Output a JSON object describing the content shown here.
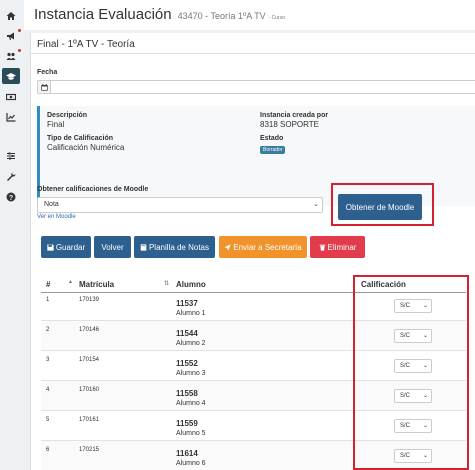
{
  "page": {
    "title": "Instancia Evaluación",
    "subtitle": "43470 - Teoría 1ºA TV",
    "subtitle_small": "- Curso"
  },
  "panel": {
    "heading": "Final - 1ºA TV - Teoría",
    "fecha_label": "Fecha",
    "fecha_value": ""
  },
  "info": {
    "descripcion_label": "Descripción",
    "descripcion_value": "Final",
    "tipo_label": "Tipo de Calificación",
    "tipo_value": "Calificación Numérica",
    "creada_label": "Instancia creada por",
    "creada_value": "8318 SOPORTE",
    "estado_label": "Estado",
    "estado_value": "Borrador"
  },
  "moodle": {
    "label": "Obtener calificaciones de Moodle",
    "select_value": "Nota",
    "link": "Ver en Moodle",
    "button": "Obtener de Moodle"
  },
  "actions": {
    "guardar": "Guardar",
    "volver": "Volver",
    "planilla": "Planilla de Notas",
    "enviar": "Enviar a Secretaría",
    "eliminar": "Eliminar"
  },
  "table": {
    "headers": {
      "num": "#",
      "matricula": "Matrícula",
      "alumno": "Alumno",
      "calificacion": "Calificación"
    },
    "rows": [
      {
        "num": "1",
        "matricula": "170139",
        "code": "11537",
        "name": "Alumno 1",
        "grade": "S/C"
      },
      {
        "num": "2",
        "matricula": "170146",
        "code": "11544",
        "name": "Alumno 2",
        "grade": "S/C"
      },
      {
        "num": "3",
        "matricula": "170154",
        "code": "11552",
        "name": "Alumno 3",
        "grade": "S/C"
      },
      {
        "num": "4",
        "matricula": "170160",
        "code": "11558",
        "name": "Alumno 4",
        "grade": "S/C"
      },
      {
        "num": "5",
        "matricula": "170161",
        "code": "11559",
        "name": "Alumno 5",
        "grade": "S/C"
      },
      {
        "num": "6",
        "matricula": "170215",
        "code": "11614",
        "name": "Alumno 6",
        "grade": "S/C"
      }
    ]
  },
  "colors": {
    "primary": "#2d5f8f",
    "warning": "#f0932b",
    "danger": "#e23b4b",
    "highlight": "#d42030"
  },
  "sidebar_icons": [
    "home-icon",
    "megaphone-icon",
    "users-icon",
    "graduation-cap-icon",
    "money-icon",
    "chart-icon",
    "sliders-icon",
    "wrench-icon",
    "question-icon"
  ]
}
